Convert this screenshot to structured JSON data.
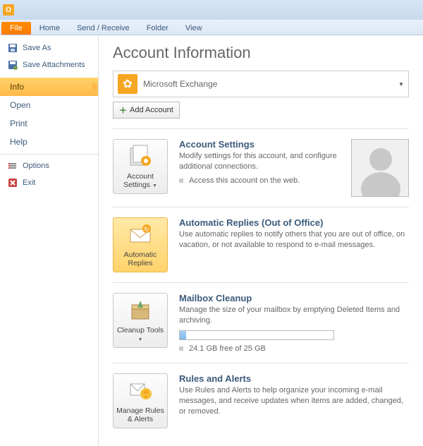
{
  "ribbon": {
    "tabs": [
      "File",
      "Home",
      "Send / Receive",
      "Folder",
      "View"
    ],
    "active": "File"
  },
  "sidebar": {
    "save_as": "Save As",
    "save_attachments": "Save Attachments",
    "info": "Info",
    "open": "Open",
    "print": "Print",
    "help": "Help",
    "options": "Options",
    "exit": "Exit"
  },
  "main": {
    "title": "Account Information",
    "account_name": "Microsoft Exchange",
    "add_account": "Add Account",
    "sections": {
      "settings": {
        "btn": "Account Settings",
        "title": "Account Settings",
        "desc": "Modify settings for this account, and configure additional connections.",
        "bullet": "Access this account on the web."
      },
      "auto": {
        "btn": "Automatic Replies",
        "title": "Automatic Replies (Out of Office)",
        "desc": "Use automatic replies to notify others that you are out of office, on vacation, or not available to respond to e-mail messages."
      },
      "cleanup": {
        "btn": "Cleanup Tools",
        "title": "Mailbox Cleanup",
        "desc": "Manage the size of your mailbox by emptying Deleted Items and archiving.",
        "storage": "24.1 GB free of 25 GB"
      },
      "rules": {
        "btn": "Manage Rules & Alerts",
        "title": "Rules and Alerts",
        "desc": "Use Rules and Alerts to help organize your incoming e-mail messages, and receive updates when items are added, changed, or removed."
      }
    }
  }
}
